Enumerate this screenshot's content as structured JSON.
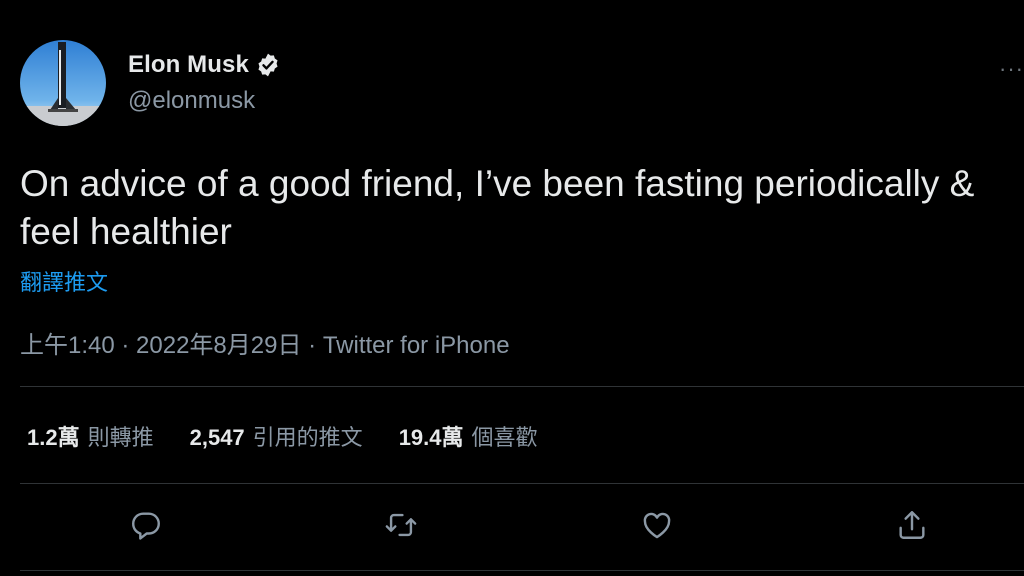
{
  "user": {
    "display_name": "Elon Musk",
    "handle": "@elonmusk",
    "avatar_icon": "rocket-launch-avatar",
    "verified_icon": "verified-badge-icon"
  },
  "tweet": {
    "text": "On advice of a good friend, I’ve been fasting periodically & feel healthier",
    "translate_label": "翻譯推文",
    "time": "上午1:40",
    "separator": " · ",
    "date": "2022年8月29日",
    "source": "Twitter for iPhone"
  },
  "stats": [
    {
      "value": "1.2萬",
      "label": "則轉推"
    },
    {
      "value": "2,547",
      "label": "引用的推文"
    },
    {
      "value": "19.4萬",
      "label": "個喜歡"
    }
  ],
  "actions": [
    {
      "name": "reply",
      "icon": "reply-icon"
    },
    {
      "name": "retweet",
      "icon": "retweet-icon"
    },
    {
      "name": "like",
      "icon": "heart-icon"
    },
    {
      "name": "share",
      "icon": "share-icon"
    }
  ],
  "colors": {
    "background": "#000000",
    "text": "#e7e9ea",
    "secondary": "#8b98a5",
    "link": "#1d9bf0",
    "divider": "#2f3336"
  }
}
